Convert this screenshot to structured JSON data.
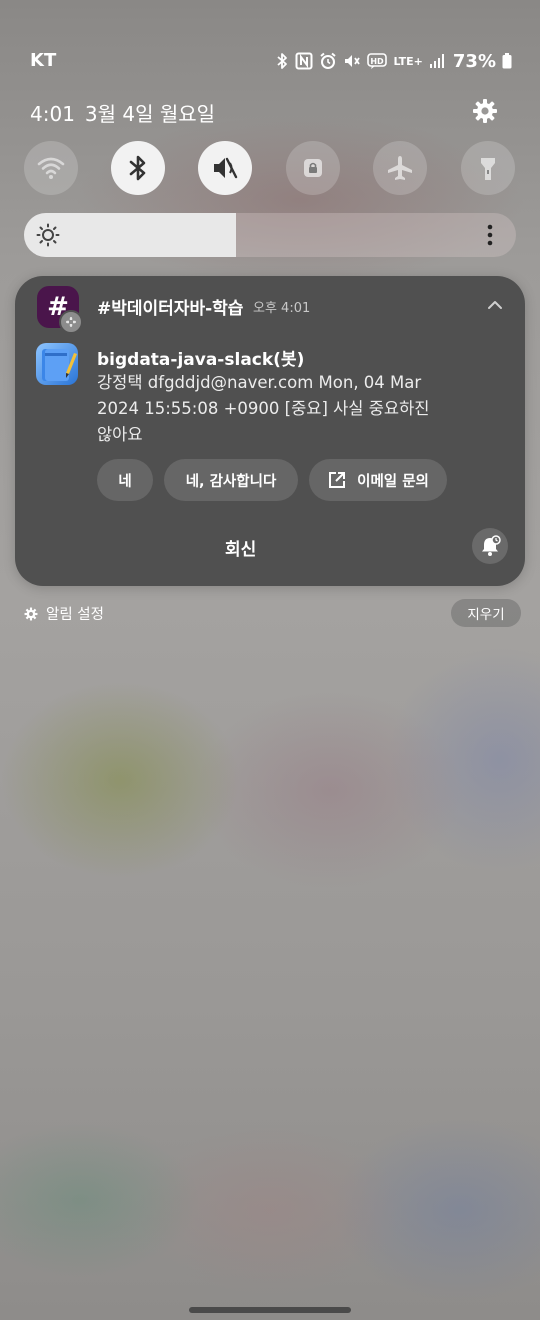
{
  "status_bar": {
    "carrier": "KT",
    "network": "LTE+",
    "battery": "73%",
    "icons": [
      "bluetooth-icon",
      "nfc-icon",
      "alarm-icon",
      "vibrate-icon",
      "hd-voice-icon",
      "lte-icon",
      "signal-icon",
      "battery-icon"
    ]
  },
  "header": {
    "time": "4:01",
    "date": "3월 4일 월요일"
  },
  "quick_toggles": [
    {
      "icon": "wifi-icon",
      "active": false
    },
    {
      "icon": "bluetooth-icon",
      "active": true
    },
    {
      "icon": "sound-mute-icon",
      "active": true
    },
    {
      "icon": "rotation-lock-icon",
      "active": false
    },
    {
      "icon": "airplane-icon",
      "active": false
    },
    {
      "icon": "flashlight-icon",
      "active": false
    }
  ],
  "brightness": {
    "level": 0.43
  },
  "notification": {
    "app_icon_glyph": "#",
    "channel": "#박데이터자바-학습",
    "time": "오후 4:01",
    "sender": "bigdata-java-slack(봇)",
    "message": "강정택 dfgddjd@naver.com Mon, 04 Mar\n2024 15:55:08 +0900 [중요] 사실 중요하진\n않아요",
    "actions": [
      "네",
      "네, 감사합니다",
      "이메일 문의"
    ],
    "reply": "회신"
  },
  "footer": {
    "settings_label": "알림 설정",
    "clear_label": "지우기"
  },
  "colors": {
    "card": "#505050",
    "slack_aubergine": "#4a154b",
    "toggle_on": "#f2f2f2"
  }
}
